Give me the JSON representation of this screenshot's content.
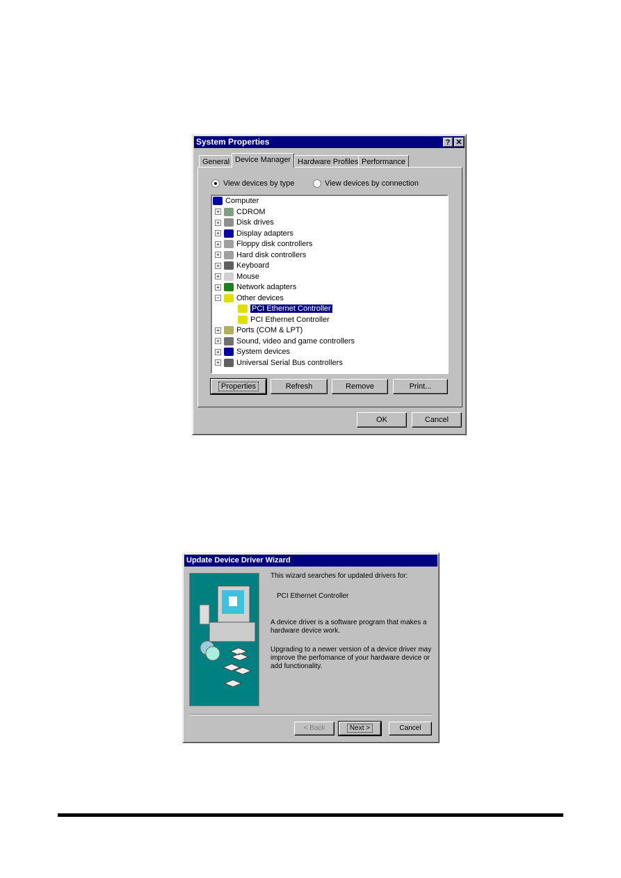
{
  "system_properties": {
    "title": "System Properties",
    "help_btn": "?",
    "close_btn": "✕",
    "tabs": [
      "General",
      "Device Manager",
      "Hardware Profiles",
      "Performance"
    ],
    "active_tab": "Device Manager",
    "radio_type": "View devices by type",
    "radio_connection": "View devices by connection",
    "selected_view": "type",
    "tree": [
      {
        "label": "Computer",
        "level": 0,
        "icon": "computer-icon"
      },
      {
        "label": "CDROM",
        "level": 1,
        "expander": "+",
        "icon": "cdrom-icon"
      },
      {
        "label": "Disk drives",
        "level": 1,
        "expander": "+",
        "icon": "disk-icon"
      },
      {
        "label": "Display adapters",
        "level": 1,
        "expander": "+",
        "icon": "monitor-icon"
      },
      {
        "label": "Floppy disk controllers",
        "level": 1,
        "expander": "+",
        "icon": "controller-icon"
      },
      {
        "label": "Hard disk controllers",
        "level": 1,
        "expander": "+",
        "icon": "controller-icon"
      },
      {
        "label": "Keyboard",
        "level": 1,
        "expander": "+",
        "icon": "keyboard-icon"
      },
      {
        "label": "Mouse",
        "level": 1,
        "expander": "+",
        "icon": "mouse-icon"
      },
      {
        "label": "Network adapters",
        "level": 1,
        "expander": "+",
        "icon": "network-icon"
      },
      {
        "label": "Other devices",
        "level": 1,
        "expander": "−",
        "icon": "question-icon"
      },
      {
        "label": "PCI Ethernet Controller",
        "level": 2,
        "icon": "unknown-device-icon",
        "selected": true
      },
      {
        "label": "PCI Ethernet Controller",
        "level": 2,
        "icon": "unknown-device-icon"
      },
      {
        "label": "Ports (COM & LPT)",
        "level": 1,
        "expander": "+",
        "icon": "port-icon"
      },
      {
        "label": "Sound, video and game controllers",
        "level": 1,
        "expander": "+",
        "icon": "sound-icon"
      },
      {
        "label": "System devices",
        "level": 1,
        "expander": "+",
        "icon": "system-icon"
      },
      {
        "label": "Universal Serial Bus controllers",
        "level": 1,
        "expander": "+",
        "icon": "usb-icon"
      }
    ],
    "buttons": {
      "properties": "Properties",
      "refresh": "Refresh",
      "remove": "Remove",
      "print": "Print...",
      "ok": "OK",
      "cancel": "Cancel"
    }
  },
  "wizard": {
    "title": "Update Device Driver Wizard",
    "intro": "This wizard searches for updated drivers for:",
    "device": "PCI Ethernet Controller",
    "para1": "A device driver is a software program that makes a hardware device work.",
    "para2": "Upgrading to a newer version of a device driver may improve the perfomance of your hardware device or add functionality.",
    "buttons": {
      "back": "< Back",
      "next": "Next >",
      "cancel": "Cancel"
    },
    "panel_color": "#008080"
  }
}
